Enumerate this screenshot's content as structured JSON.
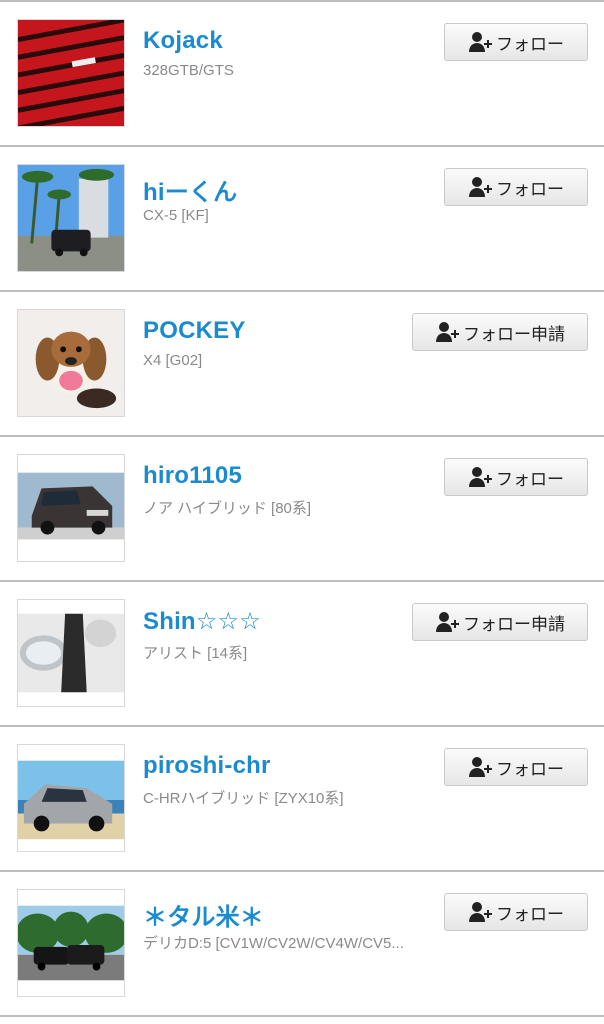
{
  "users": [
    {
      "name": "Kojack",
      "car": "328GTB/GTS",
      "button": "フォロー",
      "thumb": "red-grille-photo"
    },
    {
      "name": "hiーくん",
      "car": "CX-5 [KF]",
      "button": "フォロー",
      "thumb": "palm-tree-suv-photo"
    },
    {
      "name": "POCKEY",
      "car": "X4 [G02]",
      "button": "フォロー申請",
      "thumb": "plush-dog-photo"
    },
    {
      "name": "hiro1105",
      "car": "ノア ハイブリッド [80系]",
      "button": "フォロー",
      "thumb": "minivan-photo"
    },
    {
      "name": "Shin☆☆☆",
      "car": "アリスト [14系]",
      "button": "フォロー申請",
      "thumb": "headlight-photo"
    },
    {
      "name": "piroshi-chr",
      "car": "C-HRハイブリッド [ZYX10系]",
      "button": "フォロー",
      "thumb": "beach-car-photo"
    },
    {
      "name": "＊タル米＊",
      "car": "デリカD:5 [CV1W/CV2W/CV4W/CV5...",
      "button": "フォロー",
      "thumb": "two-cars-photo"
    }
  ],
  "colors": {
    "username": "#1b8bd0",
    "subtext": "#8a8a8a",
    "divider": "#bdbdbd"
  }
}
